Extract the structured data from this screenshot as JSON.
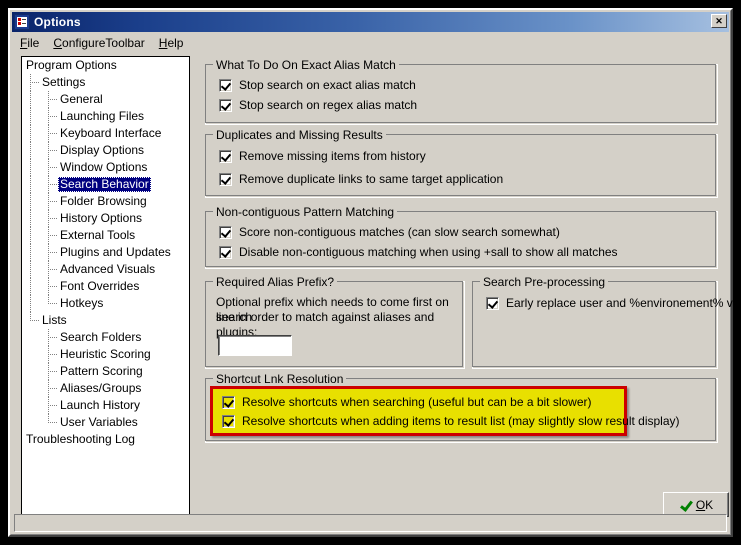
{
  "window": {
    "title": "Options",
    "icon": "options-checklist-icon",
    "close_label": "✕"
  },
  "menubar": {
    "items": [
      {
        "label": "File",
        "accel": "F"
      },
      {
        "label": "ConfigureToolbar",
        "accel": "C"
      },
      {
        "label": "Help",
        "accel": "H"
      }
    ]
  },
  "tree": {
    "selected": "Search Behavior",
    "items": [
      {
        "label": "Program Options",
        "depth": 0
      },
      {
        "label": "Settings",
        "depth": 1
      },
      {
        "label": "General",
        "depth": 2
      },
      {
        "label": "Launching Files",
        "depth": 2
      },
      {
        "label": "Keyboard Interface",
        "depth": 2
      },
      {
        "label": "Display Options",
        "depth": 2
      },
      {
        "label": "Window Options",
        "depth": 2
      },
      {
        "label": "Search Behavior",
        "depth": 2
      },
      {
        "label": "Folder Browsing",
        "depth": 2
      },
      {
        "label": "History Options",
        "depth": 2
      },
      {
        "label": "External Tools",
        "depth": 2
      },
      {
        "label": "Plugins and Updates",
        "depth": 2
      },
      {
        "label": "Advanced Visuals",
        "depth": 2
      },
      {
        "label": "Font Overrides",
        "depth": 2
      },
      {
        "label": "Hotkeys",
        "depth": 2
      },
      {
        "label": "Lists",
        "depth": 1
      },
      {
        "label": "Search Folders",
        "depth": 2
      },
      {
        "label": "Heuristic Scoring",
        "depth": 2
      },
      {
        "label": "Pattern Scoring",
        "depth": 2
      },
      {
        "label": "Aliases/Groups",
        "depth": 2
      },
      {
        "label": "Launch History",
        "depth": 2
      },
      {
        "label": "User Variables",
        "depth": 2
      },
      {
        "label": "Troubleshooting Log",
        "depth": 0
      }
    ]
  },
  "groups": {
    "exact_alias": {
      "title": "What To Do On Exact Alias Match",
      "checkboxes": [
        {
          "label": "Stop search on exact alias match",
          "checked": true
        },
        {
          "label": "Stop search on regex alias match",
          "checked": true
        }
      ]
    },
    "duplicates": {
      "title": "Duplicates and Missing Results",
      "checkboxes": [
        {
          "label": "Remove missing items from history",
          "checked": true
        },
        {
          "label": "Remove duplicate links to same target application",
          "checked": true
        }
      ]
    },
    "noncontiguous": {
      "title": "Non-contiguous Pattern Matching",
      "checkboxes": [
        {
          "label": "Score non-contiguous matches (can slow search somewhat)",
          "checked": true
        },
        {
          "label": "Disable non-contiguous matching when using +sall to show all matches",
          "checked": true
        }
      ]
    },
    "alias_prefix": {
      "title": "Required Alias Prefix?",
      "description_line1": "Optional prefix which needs to come first on search",
      "description_line2": "line in order to match against aliases and plugins:",
      "input_value": "",
      "input_placeholder": ""
    },
    "preprocessing": {
      "title": "Search Pre-processing",
      "checkboxes": [
        {
          "label": "Early replace user and %environement% vars",
          "checked": true
        }
      ]
    },
    "shortcut_resolution": {
      "title": "Shortcut Lnk Resolution",
      "highlighted": true,
      "highlight_fill": "#e8e000",
      "highlight_border": "#cc0000",
      "checkboxes": [
        {
          "label": "Resolve shortcuts when searching (useful but can be a bit slower)",
          "checked": true
        },
        {
          "label": "Resolve shortcuts when adding items to result list (may slightly slow result display)",
          "checked": true
        }
      ]
    }
  },
  "buttons": {
    "ok": {
      "label": "OK",
      "accel": "O",
      "icon": "green-check-icon"
    }
  },
  "statusbar": {
    "text": ""
  },
  "colors": {
    "face": "#d4d0c8",
    "title_gradient_start": "#0a246a",
    "title_gradient_end": "#a6c0e0",
    "selection": "#000080",
    "highlight_yellow": "#e8e000",
    "highlight_red": "#cc0000",
    "ok_check_green": "#008000"
  }
}
